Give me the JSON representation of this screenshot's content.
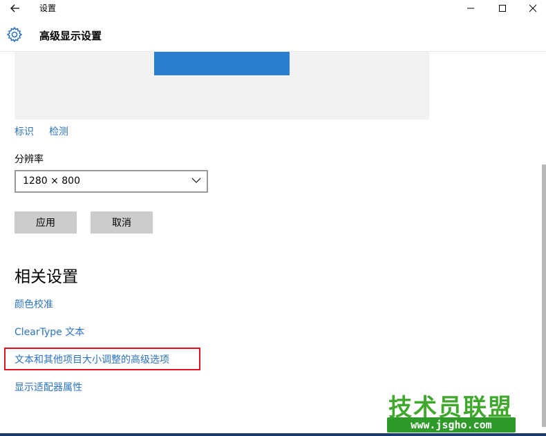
{
  "window": {
    "title": "设置",
    "controls": {
      "minimize": "—",
      "maximize": "☐",
      "close": "✕"
    }
  },
  "header": {
    "title": "高级显示设置"
  },
  "display_links": {
    "identify": "标识",
    "detect": "检测"
  },
  "resolution": {
    "label": "分辨率",
    "value": "1280 × 800"
  },
  "buttons": {
    "apply": "应用",
    "cancel": "取消"
  },
  "related": {
    "heading": "相关设置",
    "links": [
      "颜色校准",
      "ClearType 文本",
      "文本和其他项目大小调整的高级选项",
      "显示适配器属性"
    ]
  },
  "watermark": {
    "name": "技术员联盟",
    "url": "www.jsgho.com"
  },
  "colors": {
    "accent": "#2b73c0",
    "monitor": "#2b7fd1",
    "highlight": "#e0141e",
    "watermark": "#3fa82d"
  }
}
